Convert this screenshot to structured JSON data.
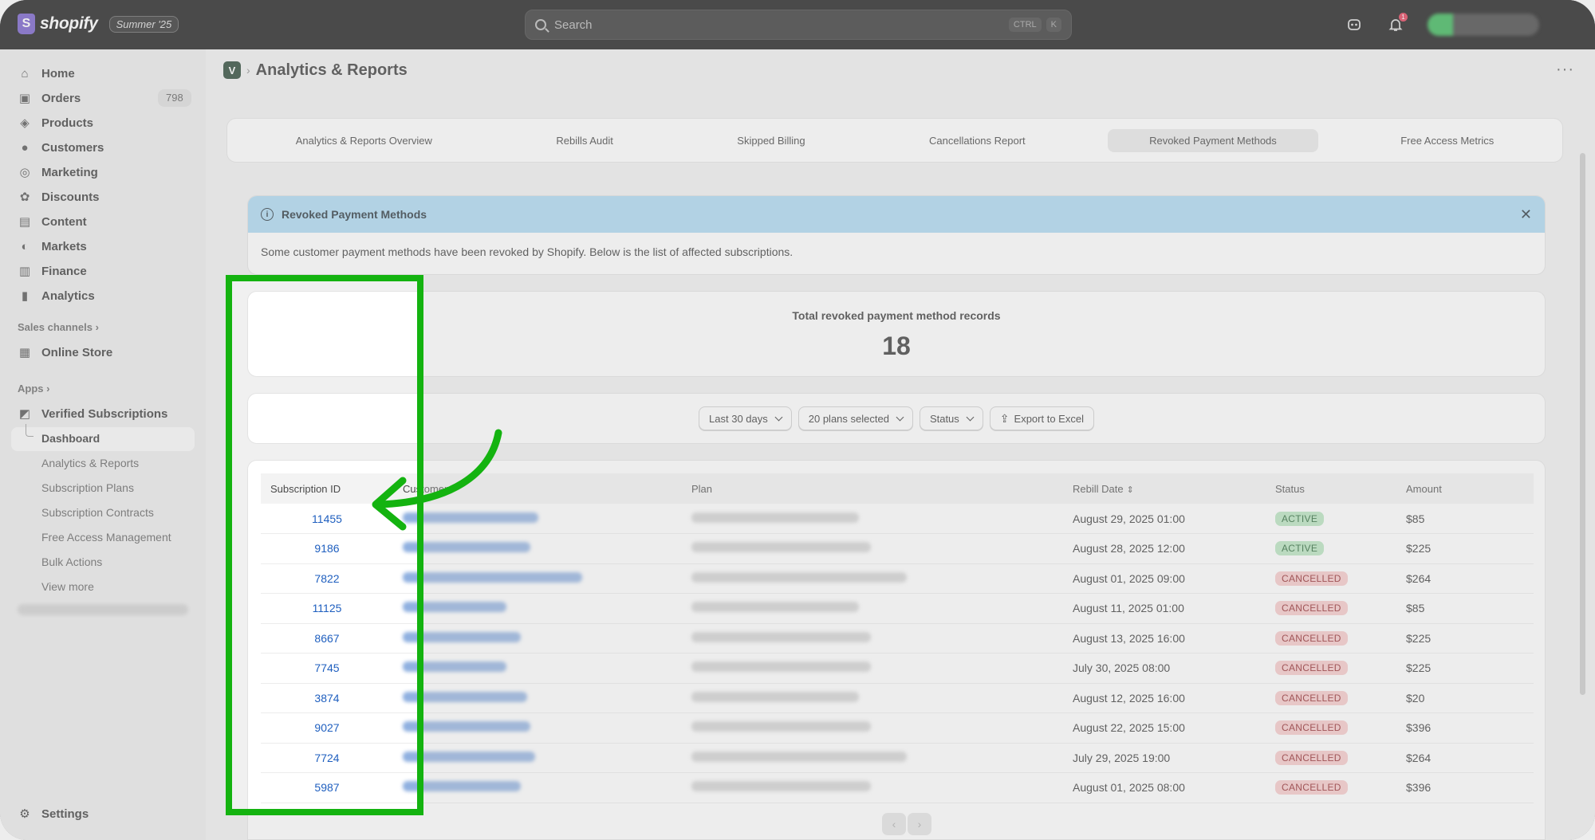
{
  "topbar": {
    "logo_text": "shopify",
    "edition_badge": "Summer '25",
    "search_placeholder": "Search",
    "kbd_ctrl": "CTRL",
    "kbd_k": "K",
    "notification_count": "1"
  },
  "sidebar": {
    "items": [
      {
        "label": "Home",
        "icon": "home-icon"
      },
      {
        "label": "Orders",
        "icon": "orders-icon",
        "count": "798"
      },
      {
        "label": "Products",
        "icon": "tag-icon"
      },
      {
        "label": "Customers",
        "icon": "person-icon"
      },
      {
        "label": "Marketing",
        "icon": "target-icon"
      },
      {
        "label": "Discounts",
        "icon": "discount-icon"
      },
      {
        "label": "Content",
        "icon": "content-icon"
      },
      {
        "label": "Markets",
        "icon": "globe-icon"
      },
      {
        "label": "Finance",
        "icon": "bank-icon"
      },
      {
        "label": "Analytics",
        "icon": "bar-chart-icon"
      }
    ],
    "sales_channels_label": "Sales channels",
    "online_store_label": "Online Store",
    "apps_label": "Apps",
    "app_name": "Verified Subscriptions",
    "app_subitems": [
      "Dashboard",
      "Analytics & Reports",
      "Subscription Plans",
      "Subscription Contracts",
      "Free Access Management",
      "Bulk Actions",
      "View more"
    ],
    "settings_label": "Settings"
  },
  "page": {
    "title": "Analytics & Reports",
    "tabs": [
      "Analytics & Reports Overview",
      "Rebills Audit",
      "Skipped Billing",
      "Cancellations Report",
      "Revoked Payment Methods",
      "Free Access Metrics"
    ],
    "active_tab": "Revoked Payment Methods"
  },
  "banner": {
    "title": "Revoked Payment Methods",
    "body": "Some customer payment methods have been revoked by Shopify. Below is the list of affected subscriptions."
  },
  "summary": {
    "label": "Total revoked payment method records",
    "value": "18"
  },
  "filters": {
    "date_range": "Last 30 days",
    "plans": "20 plans selected",
    "status": "Status",
    "export": "Export to Excel"
  },
  "table": {
    "headers": [
      "Subscription ID",
      "Customer",
      "Plan",
      "Rebill Date",
      "Status",
      "Amount"
    ],
    "rows": [
      {
        "id": "11455",
        "rebill_date": "August 29, 2025 01:00",
        "status": "ACTIVE",
        "amount": "$85"
      },
      {
        "id": "9186",
        "rebill_date": "August 28, 2025 12:00",
        "status": "ACTIVE",
        "amount": "$225"
      },
      {
        "id": "7822",
        "rebill_date": "August 01, 2025 09:00",
        "status": "CANCELLED",
        "amount": "$264"
      },
      {
        "id": "11125",
        "rebill_date": "August 11, 2025 01:00",
        "status": "CANCELLED",
        "amount": "$85"
      },
      {
        "id": "8667",
        "rebill_date": "August 13, 2025 16:00",
        "status": "CANCELLED",
        "amount": "$225"
      },
      {
        "id": "7745",
        "rebill_date": "July 30, 2025 08:00",
        "status": "CANCELLED",
        "amount": "$225"
      },
      {
        "id": "3874",
        "rebill_date": "August 12, 2025 16:00",
        "status": "CANCELLED",
        "amount": "$20"
      },
      {
        "id": "9027",
        "rebill_date": "August 22, 2025 15:00",
        "status": "CANCELLED",
        "amount": "$396"
      },
      {
        "id": "7724",
        "rebill_date": "July 29, 2025 19:00",
        "status": "CANCELLED",
        "amount": "$264"
      },
      {
        "id": "5987",
        "rebill_date": "August 01, 2025 08:00",
        "status": "CANCELLED",
        "amount": "$396"
      }
    ]
  },
  "colors": {
    "highlight": "#14b310",
    "link": "#1f5fbf",
    "banner": "#a8d8f2",
    "active_badge": "#b5e3bd",
    "cancelled_badge": "#f6c7c8"
  }
}
